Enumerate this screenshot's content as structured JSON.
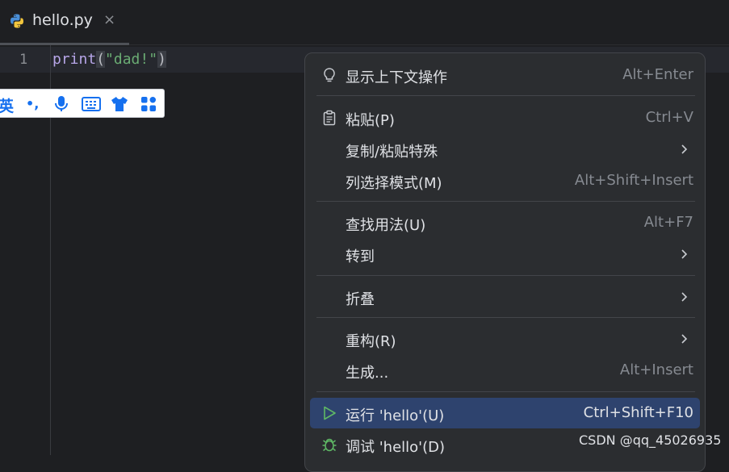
{
  "tab": {
    "filename": "hello.py",
    "close": "×"
  },
  "editor": {
    "line_number": "1",
    "code": {
      "fn": "print",
      "open": "(",
      "str": "\"dad!\"",
      "close": ")"
    }
  },
  "ime": {
    "mode": "英",
    "punct": "•,",
    "icons": [
      "microphone-icon",
      "keyboard-icon",
      "skin-icon",
      "apps-icon"
    ]
  },
  "menu": {
    "items": [
      {
        "label": "显示上下文操作",
        "shortcut": "Alt+Enter",
        "icon": "lightbulb-icon"
      },
      {
        "label": "粘贴(P)",
        "shortcut": "Ctrl+V",
        "icon": "clipboard-icon"
      },
      {
        "label": "复制/粘贴特殊",
        "shortcut": "",
        "submenu": true
      },
      {
        "label": "列选择模式(M)",
        "shortcut": "Alt+Shift+Insert"
      },
      {
        "label": "查找用法(U)",
        "shortcut": "Alt+F7"
      },
      {
        "label": "转到",
        "shortcut": "",
        "submenu": true
      },
      {
        "label": "折叠",
        "shortcut": "",
        "submenu": true
      },
      {
        "label": "重构(R)",
        "shortcut": "",
        "submenu": true
      },
      {
        "label": "生成...",
        "shortcut": "Alt+Insert"
      },
      {
        "label": "运行 'hello'(U)",
        "shortcut": "Ctrl+Shift+F10",
        "icon": "run-icon",
        "selected": true
      },
      {
        "label": "调试 'hello'(D)",
        "shortcut": "",
        "icon": "debug-icon"
      }
    ]
  },
  "watermark": "CSDN @qq_45026935",
  "colors": {
    "background": "#1e1f22",
    "menu_bg": "#2b2d30",
    "selection": "#2e436e",
    "run_green": "#5fb865",
    "ime_blue": "#1570ef"
  }
}
